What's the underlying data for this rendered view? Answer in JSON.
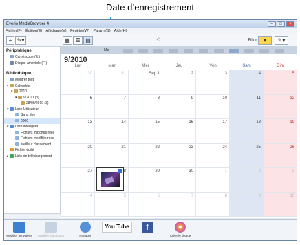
{
  "callout": {
    "label": "Date d’enregistrement"
  },
  "window": {
    "title": "Everio MediaBrowser 4",
    "menu": [
      "Fichier(F)",
      "Édition(E)",
      "Affichage(V)",
      "Fenêtre(W)",
      "Param.(S)",
      "Aide(H)"
    ],
    "filter_label": "Filtre"
  },
  "sidebar": {
    "peripherique": "Périphérique",
    "devices": [
      "Caméscope (E:)",
      "Disque amovible (F:)"
    ],
    "bibliotheque": "Bibliothèque",
    "items": [
      "Montrer tout",
      "Calendrier",
      "2010",
      "9/2010 (3)",
      "28/09/2010 (3)",
      "Liste Utilisateur",
      "Sans titre",
      "0000",
      "Liste intelligent",
      "Fichiers importés réce",
      "Fichiers modifiés réce",
      "Meilleur classement",
      "Fichier édité",
      "Liste de téléchargement"
    ]
  },
  "calendar": {
    "strip_label": "Ma",
    "month": "9/2010",
    "weekdays": [
      "Lun",
      "Mar",
      "Mer",
      "Jeu",
      "Ven",
      "Sam",
      "Dim"
    ],
    "weeks": [
      [
        "30",
        "31",
        "Sep 1",
        "2",
        "3",
        "4",
        "5"
      ],
      [
        "6",
        "7",
        "8",
        "9",
        "10",
        "11",
        "12"
      ],
      [
        "13",
        "14",
        "15",
        "16",
        "17",
        "18",
        "19"
      ],
      [
        "20",
        "21",
        "22",
        "23",
        "24",
        "25",
        "26"
      ],
      [
        "27",
        "28",
        "29",
        "30",
        "1",
        "2",
        "3"
      ],
      [
        "4",
        "5",
        "6",
        "7",
        "8",
        "9",
        "10"
      ]
    ]
  },
  "bottombar": {
    "labels": [
      "Modifier les vidéos",
      "Modifier les photos",
      "Partager",
      "You Tube",
      "f",
      "Créer le disque"
    ]
  }
}
